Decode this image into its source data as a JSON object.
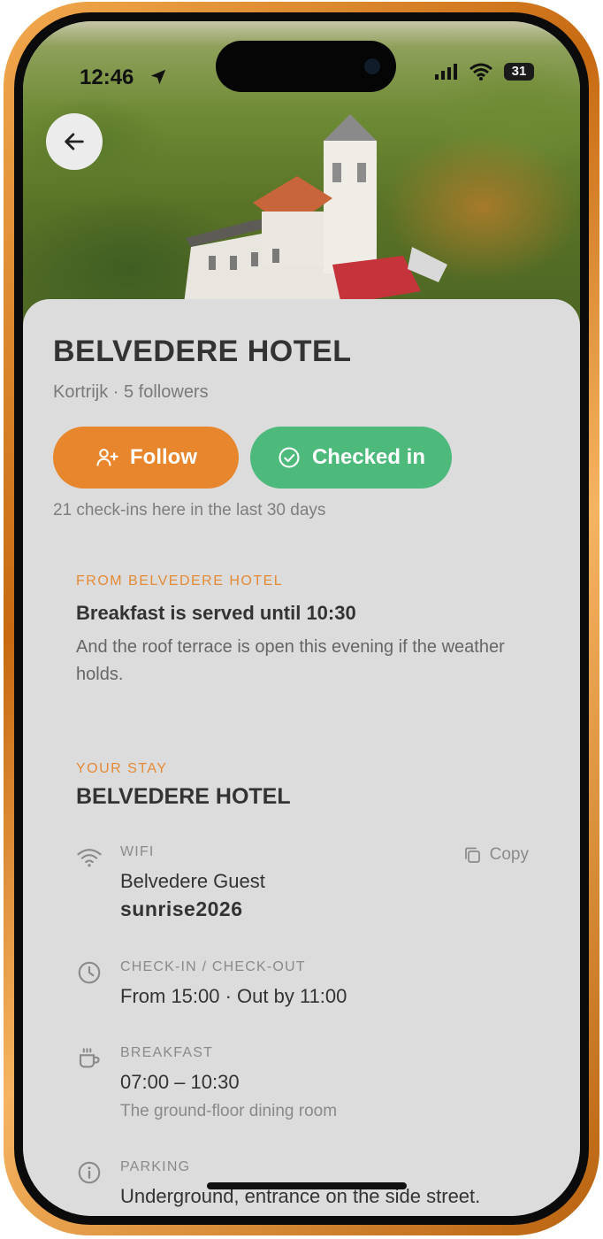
{
  "status_bar": {
    "time": "12:46",
    "battery": "31",
    "icons": [
      "location-arrow-icon",
      "cellular-signal-icon",
      "wifi-icon",
      "battery-icon"
    ]
  },
  "header": {
    "back_icon": "arrow-left-icon"
  },
  "hotel": {
    "name": "BELVEDERE HOTEL",
    "subtitle": "Kortrijk · 5 followers",
    "follow_label": "Follow",
    "checked_in_label": "Checked in",
    "checkins_text": "21 check-ins here in the last 30 days"
  },
  "announcement": {
    "eyebrow": "FROM BELVEDERE HOTEL",
    "headline": "Breakfast is served until 10:30",
    "body": "And the roof terrace is open this evening if the weather holds."
  },
  "stay": {
    "eyebrow": "YOUR STAY",
    "title": "BELVEDERE HOTEL",
    "wifi": {
      "label": "WIFI",
      "network": "Belvedere Guest",
      "password": "sunrise2026",
      "copy_label": "Copy"
    },
    "check": {
      "label": "CHECK-IN / CHECK-OUT",
      "value": "From 15:00 · Out by 11:00"
    },
    "breakfast": {
      "label": "BREAKFAST",
      "value": "07:00 – 10:30",
      "location": "The ground-floor dining room"
    },
    "parking": {
      "label": "PARKING",
      "value": "Underground, entrance on the side street. Ask at the desk for the remote."
    }
  },
  "colors": {
    "accent_orange": "#e8862e",
    "success_green": "#4dba7c",
    "sheet_bg": "#dcdcdd",
    "frame_gold": "#d98a2b"
  }
}
